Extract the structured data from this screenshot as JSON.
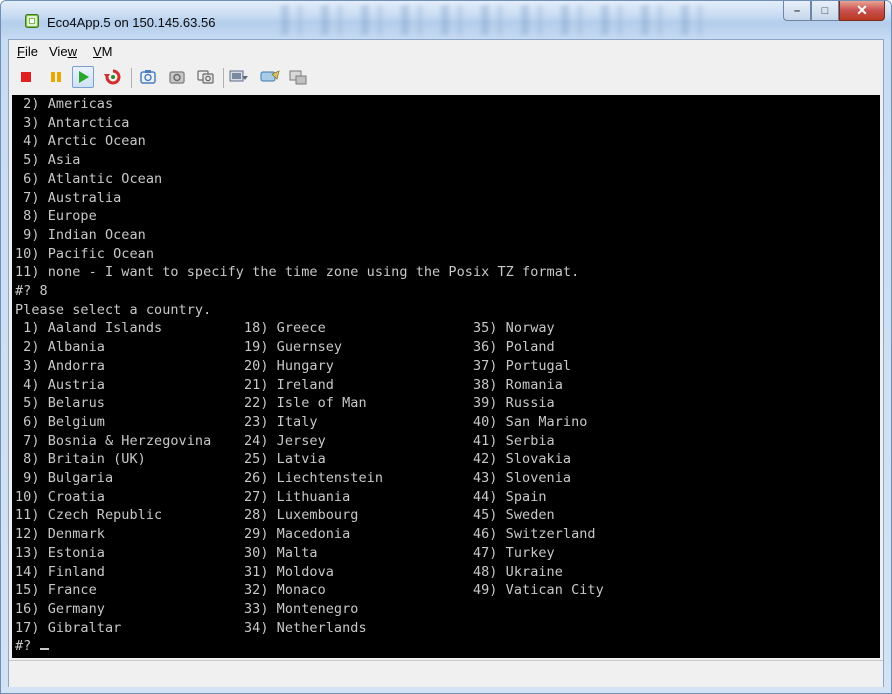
{
  "window": {
    "title": "Eco4App.5 on 150.145.63.56",
    "minimize_label": "–",
    "maximize_label": "□",
    "close_label": "✕"
  },
  "menu": {
    "file": {
      "label": "File",
      "accel": "F",
      "rest": "ile"
    },
    "view": {
      "label": "View",
      "pre": "Vie",
      "accel": "w"
    },
    "vm": {
      "label": "VM",
      "accel": "V",
      "rest": "M"
    }
  },
  "toolbar": {
    "buttons": [
      {
        "name": "power-off",
        "icon": "stop-square-icon",
        "color": "#e02020"
      },
      {
        "name": "suspend",
        "icon": "pause-icon",
        "color": "#e8a800"
      },
      {
        "name": "power-on",
        "icon": "play-icon",
        "color": "#2aa82a"
      },
      {
        "name": "reset",
        "icon": "reset-icon",
        "color": "#d03030"
      },
      {
        "name": "take-snapshot",
        "icon": "snapshot-take-icon",
        "color": "#4a7fc0"
      },
      {
        "name": "revert-snapshot",
        "icon": "snapshot-revert-icon",
        "color": "#8a8a8a"
      },
      {
        "name": "snapshot-manager",
        "icon": "snapshot-manager-icon",
        "color": "#6a6a6a"
      },
      {
        "name": "console-view",
        "icon": "console-view-icon",
        "color": "#7a8aa0"
      },
      {
        "name": "full-screen",
        "icon": "full-screen-icon",
        "color": "#5a9ad0"
      },
      {
        "name": "unity",
        "icon": "unity-icon",
        "color": "#8a8a8a"
      }
    ]
  },
  "console": {
    "lines": [
      " 2) Americas",
      " 3) Antarctica",
      " 4) Arctic Ocean",
      " 5) Asia",
      " 6) Atlantic Ocean",
      " 7) Australia",
      " 8) Europe",
      " 9) Indian Ocean",
      "10) Pacific Ocean",
      "11) none - I want to specify the time zone using the Posix TZ format.",
      "#? 8",
      "Please select a country.",
      " 1) Aaland Islands          18) Greece                  35) Norway",
      " 2) Albania                 19) Guernsey                36) Poland",
      " 3) Andorra                 20) Hungary                 37) Portugal",
      " 4) Austria                 21) Ireland                 38) Romania",
      " 5) Belarus                 22) Isle of Man             39) Russia",
      " 6) Belgium                 23) Italy                   40) San Marino",
      " 7) Bosnia & Herzegovina    24) Jersey                  41) Serbia",
      " 8) Britain (UK)            25) Latvia                  42) Slovakia",
      " 9) Bulgaria                26) Liechtenstein           43) Slovenia",
      "10) Croatia                 27) Lithuania               44) Spain",
      "11) Czech Republic          28) Luxembourg              45) Sweden",
      "12) Denmark                 29) Macedonia               46) Switzerland",
      "13) Estonia                 30) Malta                   47) Turkey",
      "14) Finland                 31) Moldova                 48) Ukraine",
      "15) France                  32) Monaco                  49) Vatican City",
      "16) Germany                 33) Montenegro",
      "17) Gibraltar               34) Netherlands"
    ],
    "prompt": "#? "
  }
}
